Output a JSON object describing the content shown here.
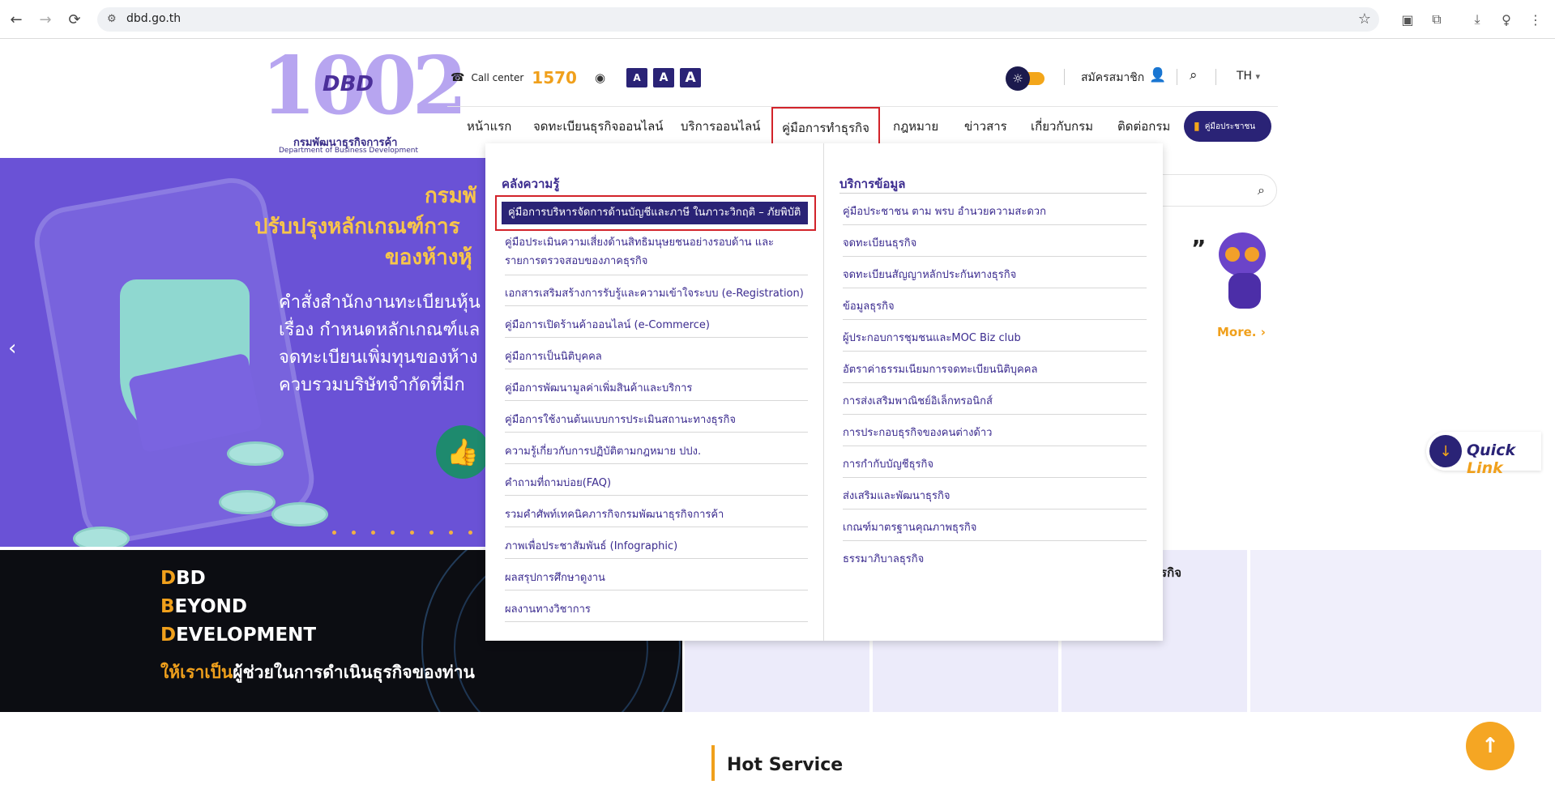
{
  "browser": {
    "url": "dbd.go.th",
    "back": "←",
    "forward": "→",
    "reload": "⟳",
    "site_info": "⚙",
    "bookmark": "☆"
  },
  "header": {
    "logo": {
      "numerals": "1002",
      "mark": "DBD",
      "name_th": "กรมพัฒนาธุรกิจการค้า",
      "name_en": "Department of Business Development"
    },
    "call_center_label": "Call center",
    "call_center_number": "1570",
    "font_size_buttons": [
      "A",
      "A",
      "A"
    ],
    "register_label": "สมัครสมาชิก",
    "language": "TH",
    "language_caret": "▾"
  },
  "nav": {
    "items": [
      "หน้าแรก",
      "จดทะเบียนธุรกิจออนไลน์",
      "บริการออนไลน์",
      "คู่มือการทำธุรกิจ",
      "กฎหมาย",
      "ข่าวสาร",
      "เกี่ยวกับกรม",
      "ติดต่อกรม"
    ],
    "active_index": 3,
    "manual_button": "คู่มือประชาชน"
  },
  "hero": {
    "title_line1": "กรมพั",
    "title_line2": "ปรับปรุงหลักเกณฑ์การ",
    "title_line3": "ของห้างหุ้",
    "body_lines": [
      "คำสั่งสำนักงานทะเบียนหุ้น",
      "เรื่อง กำหนดหลักเกณฑ์แล",
      "จดทะเบียนเพิ่มทุนของห้าง",
      "ควบรวมบริษัทจำกัดที่มีก"
    ],
    "more_label": "More.",
    "quote_mark": "”"
  },
  "quick_link": {
    "label_main": "Quick",
    "label_accent": "Link"
  },
  "mega_menu": {
    "left_title": "คลังความรู้",
    "left_items": [
      "คู่มือการบริหารจัดการด้านบัญชีและภาษี ในภาวะวิกฤติ – ภัยพิบัติ",
      "คู่มือประเมินความเสี่ยงด้านสิทธิมนุษยชนอย่างรอบด้าน และรายการตรวจสอบของภาคธุรกิจ",
      "เอกสารเสริมสร้างการรับรู้และความเข้าใจระบบ (e-Registration)",
      "คู่มือการเปิดร้านค้าออนไลน์ (e-Commerce)",
      "คู่มือการเป็นนิติบุคคล",
      "คู่มือการพัฒนามูลค่าเพิ่มสินค้าและบริการ",
      "คู่มือการใช้งานต้นแบบการประเมินสถานะทางธุรกิจ",
      "ความรู้เกี่ยวกับการปฏิบัติตามกฎหมาย ปปง.",
      "คำถามที่ถามบ่อย(FAQ)",
      "รวมคำศัพท์เทคนิคภารกิจกรมพัฒนาธุรกิจการค้า",
      "ภาพเพื่อประชาสัมพันธ์ (Infographic)",
      "ผลสรุปการศึกษาดูงาน",
      "ผลงานทางวิชาการ"
    ],
    "right_title": "บริการข้อมูล",
    "right_items": [
      "คู่มือประชาชน ตาม พรบ อำนวยความสะดวก",
      "จดทะเบียนธุรกิจ",
      "จดทะเบียนสัญญาหลักประกันทางธุรกิจ",
      "ข้อมูลธุรกิจ",
      "ผู้ประกอบการชุมชนและMOC Biz club",
      "อัตราค่าธรรมเนียมการจดทะเบียนนิติบุคคล",
      "การส่งเสริมพาณิชย์อิเล็กทรอนิกส์",
      "การประกอบธุรกิจของคนต่างด้าว",
      "การกำกับบัญชีธุรกิจ",
      "ส่งเสริมและพัฒนาธุรกิจ",
      "เกณฑ์มาตรฐานคุณภาพธุรกิจ",
      "ธรรมาภิบาลธุรกิจ"
    ]
  },
  "beyond": {
    "line1_first": "D",
    "line1_rest": "BD",
    "line2_first": "B",
    "line2_rest": "EYOND",
    "line3_first": "D",
    "line3_rest": "EVELOPMENT",
    "slogan_highlight": "ให้เราเป็น",
    "slogan_rest": "ผู้ช่วยในการดำเนินธุรกิจของท่าน"
  },
  "tiles": {
    "partial_label": "รุรกิจ"
  },
  "hot_service": {
    "title": "Hot Service"
  },
  "icons": {
    "phone": "☎",
    "rss": "◉",
    "sun": "☼",
    "user": "👤",
    "search": "⌕",
    "book": "▮",
    "prev": "‹",
    "more_arrow": "›",
    "quick_link": "↓",
    "to_top": "↑"
  },
  "colors": {
    "brand_navy": "#2a2376",
    "accent_orange": "#f0a01c",
    "hero_purple": "#5a3ec8",
    "highlight_red": "#d2232a"
  }
}
